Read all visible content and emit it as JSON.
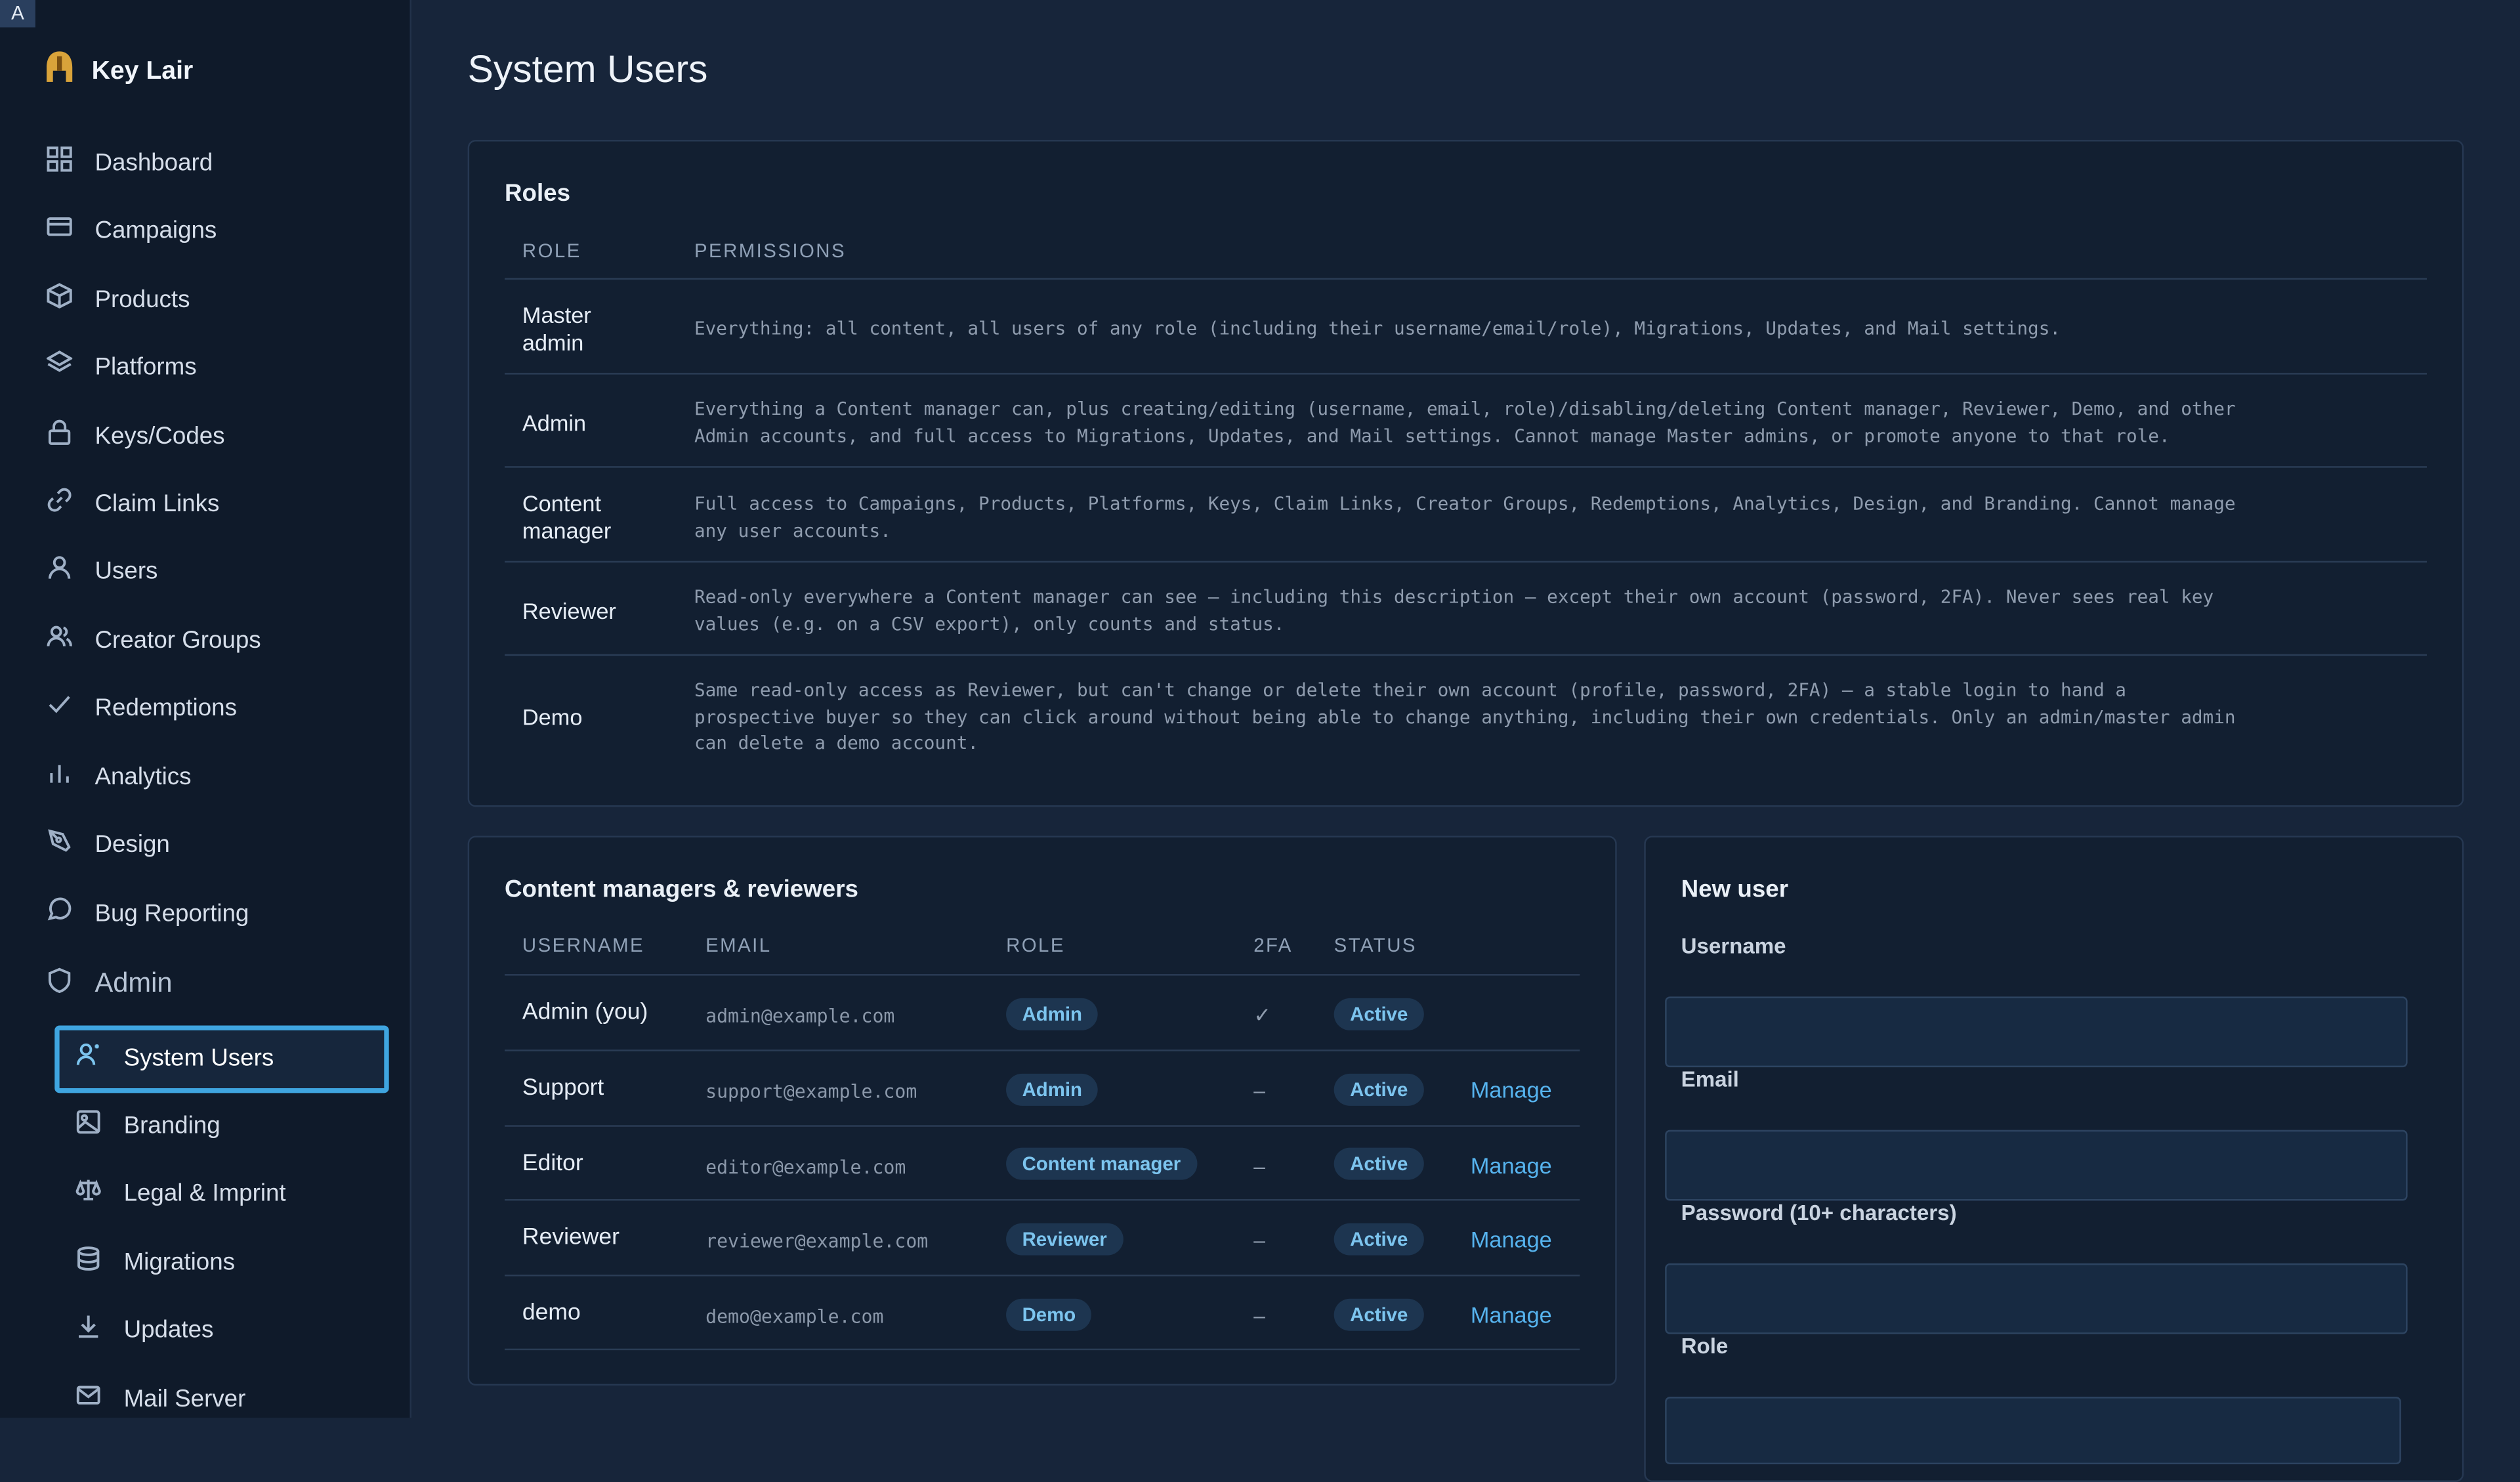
{
  "corner_label": "A",
  "brand": {
    "name": "Key Lair",
    "icon": "helmet-icon"
  },
  "sidebar": {
    "items": [
      {
        "label": "Dashboard",
        "icon": "dashboard-grid-icon"
      },
      {
        "label": "Campaigns",
        "icon": "campaigns-icon"
      },
      {
        "label": "Products",
        "icon": "box-icon"
      },
      {
        "label": "Platforms",
        "icon": "layers-icon"
      },
      {
        "label": "Keys/Codes",
        "icon": "lock-icon"
      },
      {
        "label": "Claim Links",
        "icon": "link-icon"
      },
      {
        "label": "Users",
        "icon": "user-icon"
      },
      {
        "label": "Creator Groups",
        "icon": "users-icon"
      },
      {
        "label": "Redemptions",
        "icon": "check-icon"
      },
      {
        "label": "Analytics",
        "icon": "bar-chart-icon"
      },
      {
        "label": "Design",
        "icon": "pen-tool-icon"
      },
      {
        "label": "Bug Reporting",
        "icon": "message-icon"
      }
    ],
    "admin_label": "Admin",
    "admin_items": [
      {
        "label": "System Users",
        "icon": "user-cog-icon",
        "active": true
      },
      {
        "label": "Branding",
        "icon": "image-icon"
      },
      {
        "label": "Legal & Imprint",
        "icon": "scale-icon"
      },
      {
        "label": "Migrations",
        "icon": "database-icon"
      },
      {
        "label": "Updates",
        "icon": "download-icon"
      },
      {
        "label": "Mail Server",
        "icon": "mail-icon"
      }
    ]
  },
  "page_title": "System Users",
  "roles_card": {
    "title": "Roles",
    "col_role": "ROLE",
    "col_permissions": "PERMISSIONS",
    "rows": [
      {
        "role": "Master\nadmin",
        "permissions": "Everything: all content, all users of any role (including their username/email/role), Migrations, Updates, and Mail settings."
      },
      {
        "role": "Admin",
        "permissions": "Everything a Content manager can, plus creating/editing (username, email, role)/disabling/deleting Content manager, Reviewer, Demo, and other\nAdmin accounts, and full access to Migrations, Updates, and Mail settings. Cannot manage Master admins, or promote anyone to that role."
      },
      {
        "role": "Content\nmanager",
        "permissions": "Full access to Campaigns, Products, Platforms, Keys, Claim Links, Creator Groups, Redemptions, Analytics, Design, and Branding. Cannot manage\nany user accounts."
      },
      {
        "role": "Reviewer",
        "permissions": "Read-only everywhere a Content manager can see — including this description — except their own account (password, 2FA). Never sees real key\nvalues (e.g. on a CSV export), only counts and status."
      },
      {
        "role": "Demo",
        "permissions": "Same read-only access as Reviewer, but can't change or delete their own account (profile, password, 2FA) — a stable login to hand a\nprospective buyer so they can click around without being able to change anything, including their own credentials. Only an admin/master admin\ncan delete a demo account."
      }
    ]
  },
  "users_card": {
    "title": "Content managers & reviewers",
    "columns": [
      "USERNAME",
      "EMAIL",
      "ROLE",
      "2FA",
      "STATUS"
    ],
    "rows": [
      {
        "username": "Admin (you)",
        "email": "admin@example.com",
        "role": "Admin",
        "twofa": "✓",
        "status": "Active",
        "action": ""
      },
      {
        "username": "Support",
        "email": "support@example.com",
        "role": "Admin",
        "twofa": "–",
        "status": "Active",
        "action": "Manage"
      },
      {
        "username": "Editor",
        "email": "editor@example.com",
        "role": "Content manager",
        "twofa": "–",
        "status": "Active",
        "action": "Manage"
      },
      {
        "username": "Reviewer",
        "email": "reviewer@example.com",
        "role": "Reviewer",
        "twofa": "–",
        "status": "Active",
        "action": "Manage"
      },
      {
        "username": "demo",
        "email": "demo@example.com",
        "role": "Demo",
        "twofa": "–",
        "status": "Active",
        "action": "Manage"
      }
    ]
  },
  "new_user_card": {
    "title": "New user",
    "username_label": "Username",
    "username_value": "",
    "email_label": "Email",
    "email_value": "",
    "password_label": "Password (10+ characters)",
    "password_value": "",
    "role_label": "Role",
    "role_value": ""
  },
  "colors": {
    "accent": "#3fa5e0",
    "link": "#56b3ee",
    "badge_text": "#7cc4ee",
    "bg": "#17253a",
    "sidebar_bg": "#0f1a2a"
  }
}
